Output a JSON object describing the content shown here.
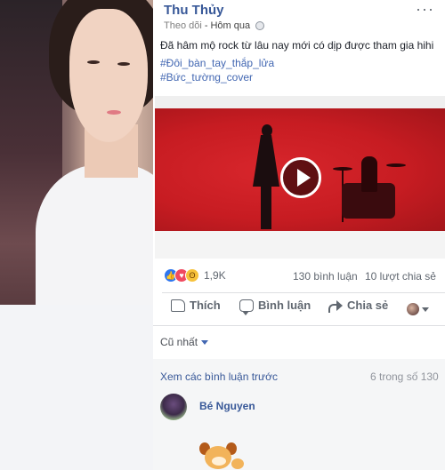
{
  "post": {
    "author": "Thu Thủy",
    "follow_label": "Theo dõi",
    "separator": "-",
    "time": "Hôm qua",
    "privacy_icon": "globe-icon",
    "more_label": "···",
    "text": "Đã hâm mộ rock từ lâu nay mới có dịp được tham gia hihi",
    "hashtags": [
      "#Đôi_bàn_tay_thắp_lửa",
      "#Bức_tường_cover"
    ]
  },
  "video": {
    "play_icon": "play-icon",
    "accent": "#c71c22"
  },
  "stats": {
    "reactions": "1,9K",
    "comments": "130 bình luận",
    "shares": "10 lượt chia sẻ"
  },
  "actions": {
    "like": "Thích",
    "comment": "Bình luận",
    "share": "Chia sẻ"
  },
  "comments": {
    "sort_label": "Cũ nhất",
    "previous_label": "Xem các bình luận trước",
    "page_count": "6 trong số 130",
    "first_commenter": "Bé Nguyen"
  },
  "colors": {
    "link": "#385898",
    "hashtag": "#4267b2",
    "like": "#2e76ef",
    "love": "#f04a60",
    "haha": "#f7c23b"
  }
}
